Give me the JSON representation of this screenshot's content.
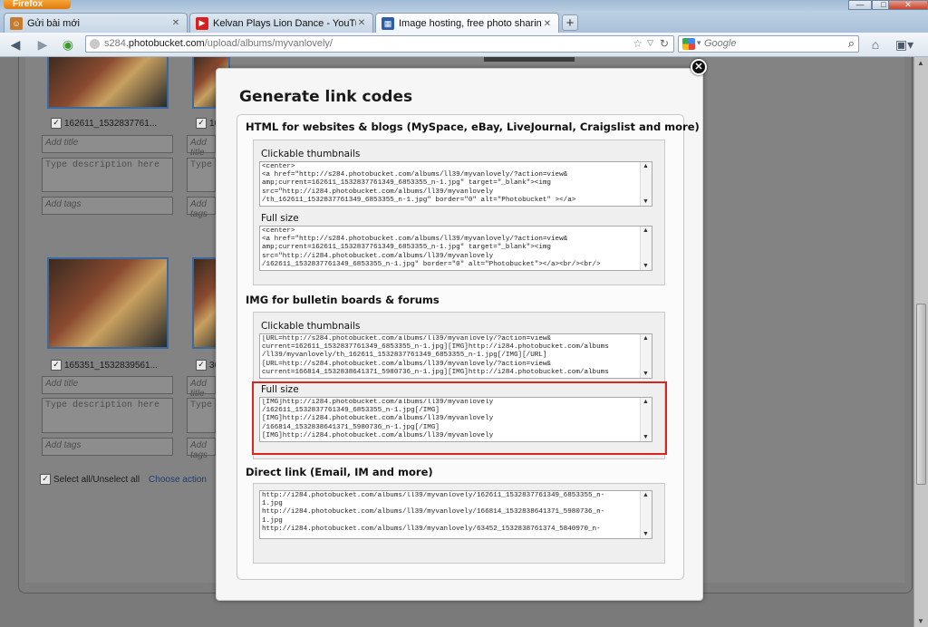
{
  "browser": {
    "menu_label": "Firefox",
    "window_controls": {
      "minimize": "—",
      "maximize": "□",
      "close": "✕"
    },
    "tabs": [
      {
        "label": "Gửi bài mới",
        "favicon": "forum-favicon",
        "active": false
      },
      {
        "label": "Kelvan Plays Lion Dance - YouTube",
        "favicon": "youtube-favicon",
        "active": false
      },
      {
        "label": "Image hosting, free photo sharing & ...",
        "favicon": "photobucket-favicon",
        "active": true
      }
    ],
    "new_tab": "+",
    "url": {
      "prefix": "s284.",
      "domain": "photobucket.com",
      "path": "/upload/albums/myvanlovely/"
    },
    "search_placeholder": "Google"
  },
  "album": {
    "items": [
      {
        "filename": "162611_1532837761...",
        "title_placeholder": "Add title",
        "desc_placeholder": "Type description here",
        "tags_placeholder": "Add tags"
      },
      {
        "filename": "16",
        "title_placeholder": "Add title",
        "desc_placeholder": "Type",
        "tags_placeholder": "Add tags"
      },
      {
        "filename": "165351_1532839561...",
        "title_placeholder": "Add title",
        "desc_placeholder": "Type description here",
        "tags_placeholder": "Add tags"
      },
      {
        "filename": "36",
        "title_placeholder": "Add title",
        "desc_placeholder": "Type",
        "tags_placeholder": "Add tags"
      }
    ],
    "select_all": "Select all/Unselect all",
    "choose_action": "Choose action"
  },
  "modal": {
    "title": "Generate link codes",
    "close": "✕",
    "sections": {
      "html": {
        "heading": "HTML for websites & blogs (MySpace, eBay, LiveJournal, Craigslist and more)",
        "clickable_label": "Clickable thumbnails",
        "clickable_code": "<center>\n<a href=\"http://s284.photobucket.com/albums/ll39/myvanlovely/?action=view&\namp;current=162611_1532837761349_6853355_n-1.jpg\" target=\"_blank\"><img\nsrc=\"http://i284.photobucket.com/albums/ll39/myvanlovely\n/th_162611_1532837761349_6853355_n-1.jpg\" border=\"0\" alt=\"Photobucket\" ></a>",
        "full_label": "Full size",
        "full_code": "<center>\n<a href=\"http://s284.photobucket.com/albums/ll39/myvanlovely/?action=view&\namp;current=162611_1532837761349_6853355_n-1.jpg\" target=\"_blank\"><img\nsrc=\"http://i284.photobucket.com/albums/ll39/myvanlovely\n/162611_1532837761349_6853355_n-1.jpg\" border=\"0\" alt=\"Photobucket\"></a><br/><br/>"
      },
      "img": {
        "heading": "IMG for bulletin boards & forums",
        "clickable_label": "Clickable thumbnails",
        "clickable_code": "[URL=http://s284.photobucket.com/albums/ll39/myvanlovely/?action=view&\ncurrent=162611_1532837761349_6853355_n-1.jpg][IMG]http://i284.photobucket.com/albums\n/ll39/myvanlovely/th_162611_1532837761349_6853355_n-1.jpg[/IMG][/URL]\n[URL=http://s284.photobucket.com/albums/ll39/myvanlovely/?action=view&\ncurrent=166814_1532838641371_5980736_n-1.jpg][IMG]http://i284.photobucket.com/albums",
        "full_label": "Full size",
        "full_code": "[IMG]http://i284.photobucket.com/albums/ll39/myvanlovely\n/162611_1532837761349_6853355_n-1.jpg[/IMG]\n[IMG]http://i284.photobucket.com/albums/ll39/myvanlovely\n/166814_1532838641371_5980736_n-1.jpg[/IMG]\n[IMG]http://i284.photobucket.com/albums/ll39/myvanlovely"
      },
      "direct": {
        "heading": "Direct link (Email, IM and more)",
        "code": "http://i284.photobucket.com/albums/ll39/myvanlovely/162611_1532837761349_6853355_n-\n1.jpg\nhttp://i284.photobucket.com/albums/ll39/myvanlovely/166814_1532838641371_5980736_n-\n1.jpg\nhttp://i284.photobucket.com/albums/ll39/myvanlovely/63452_1532838761374_5840970_n-"
      }
    }
  },
  "colors": {
    "highlight": "#d9261c",
    "link": "#1b3e78",
    "firefox_orange": "#e88a1e"
  }
}
